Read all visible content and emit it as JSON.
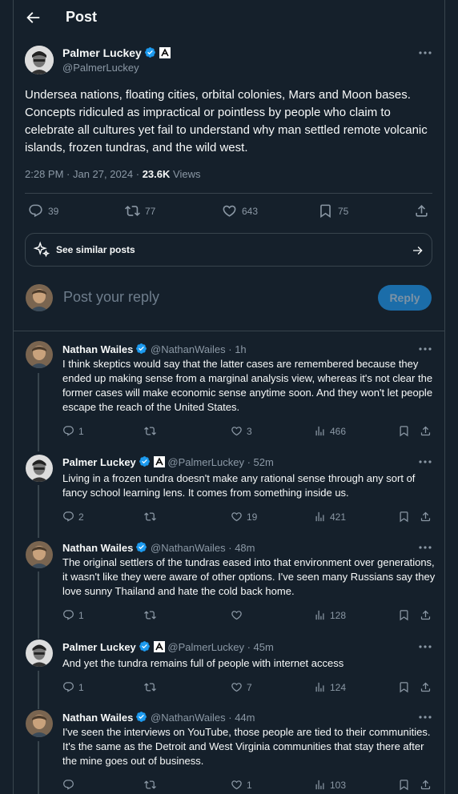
{
  "header": {
    "title": "Post"
  },
  "main_post": {
    "author": "Palmer Luckey",
    "handle": "@PalmerLuckey",
    "text": "Undersea nations, floating cities, orbital colonies, Mars and Moon bases. Concepts ridiculed as impractical or pointless by people who claim to celebrate all cultures yet fail to understand why man settled remote volcanic islands, frozen tundras, and the wild west.",
    "time": "2:28 PM · Jan 27, 2024 · ",
    "views_count": "23.6K",
    "views_label": " Views",
    "replies": "39",
    "reposts": "77",
    "likes": "643",
    "bookmarks": "75"
  },
  "similar": {
    "label": "See similar posts"
  },
  "composer": {
    "placeholder": "Post your reply",
    "button": "Reply"
  },
  "replies": [
    {
      "author": "Nathan Wailes",
      "handle": "@NathanWailes · 1h",
      "text": "I think skeptics would say that the latter cases are remembered because they ended up making sense from a marginal analysis view, whereas it's not clear the former cases will make economic sense anytime soon. And they won't let people escape the reach of the United States.",
      "replies": "1",
      "reposts": "",
      "likes": "3",
      "views": "466"
    },
    {
      "author": "Palmer Luckey",
      "handle": "@PalmerLuckey · 52m",
      "text": "Living in a frozen tundra doesn't make any rational sense through any sort of fancy school learning lens.  It comes from something inside us.",
      "replies": "2",
      "reposts": "",
      "likes": "19",
      "views": "421"
    },
    {
      "author": "Nathan Wailes",
      "handle": "@NathanWailes · 48m",
      "text": "The original settlers of the tundras eased into that environment over generations, it wasn't like they were aware of other options. I've seen many Russians say they love sunny Thailand and hate the cold back home.",
      "replies": "1",
      "reposts": "",
      "likes": "",
      "views": "128"
    },
    {
      "author": "Palmer Luckey",
      "handle": "@PalmerLuckey · 45m",
      "text": "And yet the tundra remains full of people with internet access",
      "replies": "1",
      "reposts": "",
      "likes": "7",
      "views": "124"
    },
    {
      "author": "Nathan Wailes",
      "handle": "@NathanWailes · 44m",
      "text": "I've seen the interviews on YouTube, those people are tied to their communities. It's the same as the Detroit and West Virginia communities that stay there after the mine goes out of business.",
      "replies": "",
      "reposts": "",
      "likes": "1",
      "views": "103"
    }
  ],
  "colors": {
    "background": "#15202b",
    "accent": "#1d9bf0",
    "muted": "#8b98a5",
    "border": "#38444d"
  }
}
